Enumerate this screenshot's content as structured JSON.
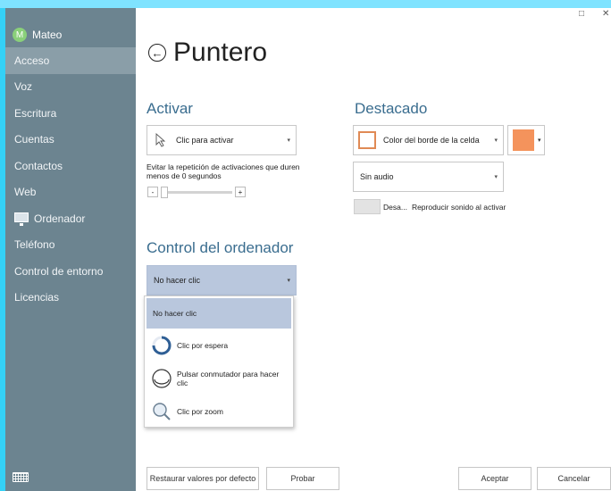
{
  "sidebar": {
    "user": {
      "initial": "M",
      "name": "Mateo"
    },
    "items": [
      {
        "label": "Acceso",
        "active": true
      },
      {
        "label": "Voz"
      },
      {
        "label": "Escritura"
      },
      {
        "label": "Cuentas"
      },
      {
        "label": "Contactos"
      },
      {
        "label": "Web"
      },
      {
        "label": "Ordenador",
        "icon": "monitor-icon"
      },
      {
        "label": "Teléfono"
      },
      {
        "label": "Control de entorno"
      },
      {
        "label": "Licencias"
      }
    ],
    "keyboard_icon": "keyboard-icon"
  },
  "window": {
    "maximize_glyph": "□",
    "close_glyph": "✕"
  },
  "header": {
    "back_glyph": "←",
    "title": "Puntero"
  },
  "activar": {
    "title": "Activar",
    "combo_value": "Clic para activar",
    "repeat_text_line1": "Evitar la repetición de activaciones que duren",
    "repeat_text_line2": "menos de 0 segundos",
    "stepper_minus": "-",
    "stepper_plus": "+"
  },
  "destacado": {
    "title": "Destacado",
    "highlight_value": "Color del borde de la celda",
    "highlight_color": "#f4935c",
    "audio_value": "Sin audio",
    "toggle_label": "Desa...",
    "toggle_desc": "Reproducir sonido al activar"
  },
  "control": {
    "title": "Control del ordenador",
    "dropdown_value": "No hacer clic",
    "options": [
      {
        "label": "No hacer clic",
        "selected": true
      },
      {
        "label": "Clic por espera",
        "icon": "dwell-progress-icon"
      },
      {
        "label_line1": "Pulsar conmutador para hacer",
        "label_line2": "clic",
        "icon": "switch-icon"
      },
      {
        "label": "Clic por zoom",
        "icon": "magnifier-icon"
      }
    ]
  },
  "buttons": {
    "restore": "Restaurar valores por defecto",
    "test": "Probar",
    "accept": "Aceptar",
    "cancel": "Cancelar"
  },
  "colors": {
    "sidebar_bg": "#6c8490",
    "sidebar_active": "#8a9ea8",
    "accent_title": "#3a6d8f",
    "selection": "#b9c7dd",
    "frame": "#34d1f6"
  }
}
